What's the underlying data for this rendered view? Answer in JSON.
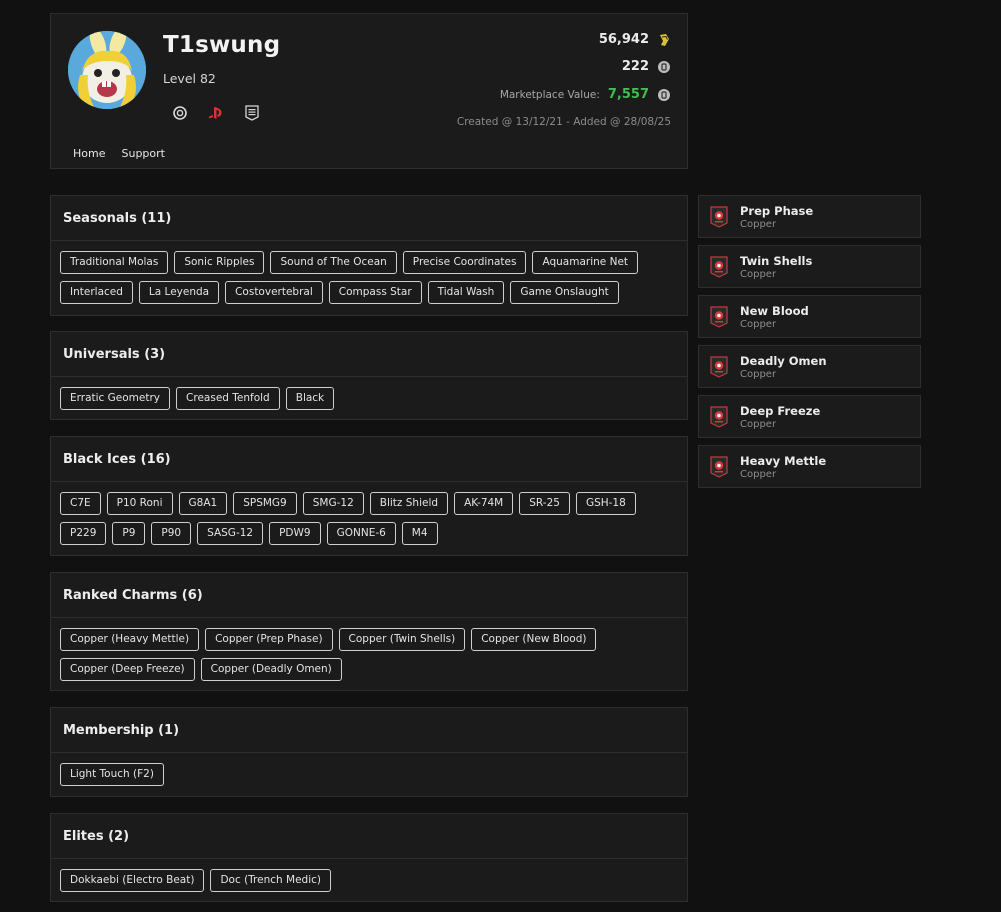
{
  "profile": {
    "username": "T1swung",
    "level": "Level 82",
    "platforms": [
      "ubisoft-icon",
      "playstation-icon",
      "epic-games-icon"
    ],
    "credits": "56,942",
    "r6_credits": "222",
    "marketplace_label": "Marketplace Value:",
    "marketplace_value": "7,557",
    "created": "Created @ 13/12/21 - Added @ 28/08/25",
    "accent_green": "#3fbf4f"
  },
  "nav": [
    "Home",
    "Support"
  ],
  "sections": [
    {
      "title": "Seasonals (11)",
      "items": [
        "Traditional Molas",
        "Sonic Ripples",
        "Sound of The Ocean",
        "Precise Coordinates",
        "Aquamarine Net",
        "Interlaced",
        "La Leyenda",
        "Costovertebral",
        "Compass Star",
        "Tidal Wash",
        "Game Onslaught"
      ]
    },
    {
      "title": "Universals (3)",
      "items": [
        "Erratic Geometry",
        "Creased Tenfold",
        "Black"
      ]
    },
    {
      "title": "Black Ices (16)",
      "items": [
        "C7E",
        "P10 Roni",
        "G8A1",
        "SPSMG9",
        "SMG-12",
        "Blitz Shield",
        "AK-74M",
        "SR-25",
        "GSH-18",
        "P229",
        "P9",
        "P90",
        "SASG-12",
        "PDW9",
        "GONNE-6",
        "M4"
      ]
    },
    {
      "title": "Ranked Charms (6)",
      "items": [
        "Copper (Heavy Mettle)",
        "Copper (Prep Phase)",
        "Copper (Twin Shells)",
        "Copper (New Blood)",
        "Copper (Deep Freeze)",
        "Copper (Deadly Omen)"
      ]
    },
    {
      "title": "Membership (1)",
      "items": [
        "Light Touch (F2)"
      ]
    },
    {
      "title": "Elites (2)",
      "items": [
        "Dokkaebi (Electro Beat)",
        "Doc (Trench Medic)"
      ]
    }
  ],
  "charms": [
    {
      "name": "Prep Phase",
      "tier": "Copper"
    },
    {
      "name": "Twin Shells",
      "tier": "Copper"
    },
    {
      "name": "New Blood",
      "tier": "Copper"
    },
    {
      "name": "Deadly Omen",
      "tier": "Copper"
    },
    {
      "name": "Deep Freeze",
      "tier": "Copper"
    },
    {
      "name": "Heavy Mettle",
      "tier": "Copper"
    }
  ]
}
